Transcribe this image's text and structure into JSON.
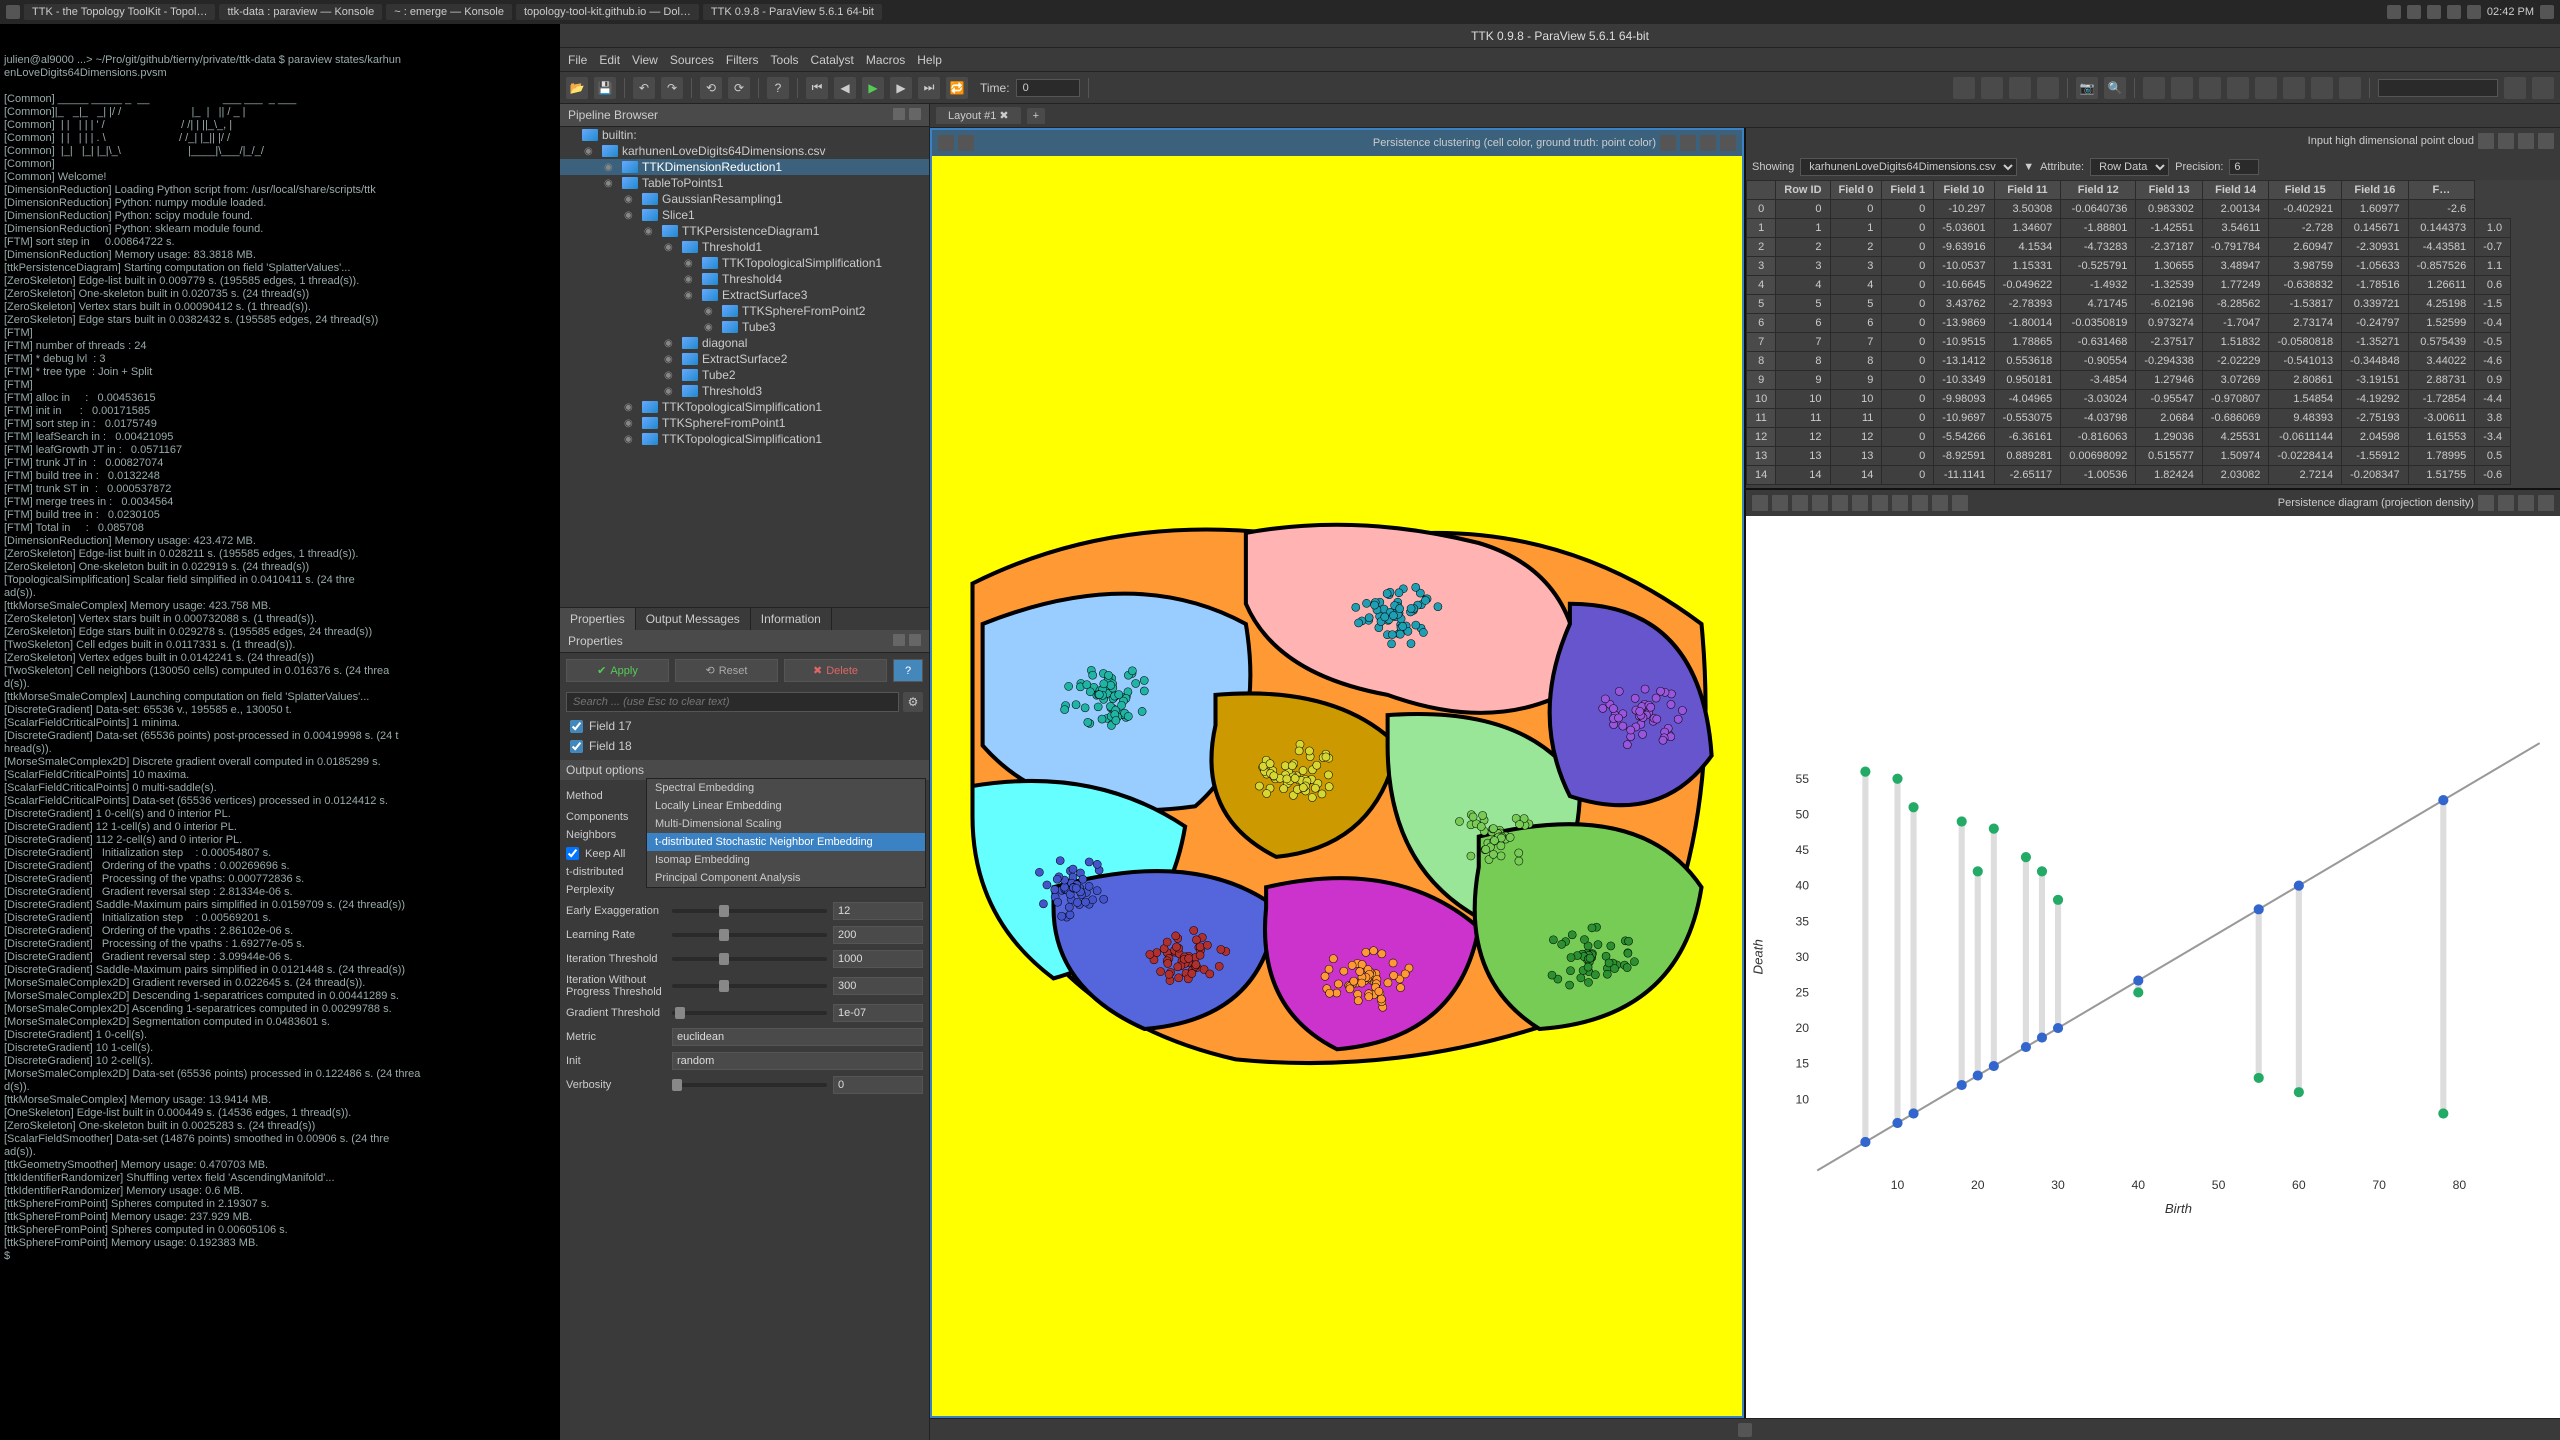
{
  "sysbar": {
    "tabs": [
      "TTK - the Topology ToolKit - Topol…",
      "ttk-data : paraview — Konsole",
      "~ : emerge — Konsole",
      "topology-tool-kit.github.io — Dol…",
      "TTK 0.9.8 - ParaView 5.6.1 64-bit"
    ],
    "clock": "02:42 PM"
  },
  "terminal_snip": "julien@al9000 ...> ~/Pro/git/github/tierny/private/ttk-data $ paraview states/karhun\nenLoveDigits64Dimensions.pvsm\n\n[Common] _____ _____ _  __                        ___ ___  _ ___\n[Common]|_   _|_   _| |/ /                       |_  |   || / _ |\n[Common]  | |   | | | ' /                         / /| | ||_\\_, |\n[Common]  | |   | | | . \\                        / /_| |_|| |/ /\n[Common]  |_|   |_| |_|\\_\\                      |____|\\___/|_/_/\n[Common]\n[Common] Welcome!\n[DimensionReduction] Loading Python script from: /usr/local/share/scripts/ttk\n[DimensionReduction] Python: numpy module loaded.\n[DimensionReduction] Python: scipy module found.\n[DimensionReduction] Python: sklearn module found.\n[FTM] sort step in     0.00864722 s.\n[DimensionReduction] Memory usage: 83.3818 MB.\n[ttkPersistenceDiagram] Starting computation on field 'SplatterValues'...\n[ZeroSkeleton] Edge-list built in 0.009779 s. (195585 edges, 1 thread(s)).\n[ZeroSkeleton] One-skeleton built in 0.020735 s. (24 thread(s))\n[ZeroSkeleton] Vertex stars built in 0.00090412 s. (1 thread(s)).\n[ZeroSkeleton] Edge stars built in 0.0382432 s. (195585 edges, 24 thread(s))\n[FTM]\n[FTM] number of threads : 24\n[FTM] * debug lvl  : 3\n[FTM] * tree type  : Join + Split\n[FTM]\n[FTM] alloc in     :   0.00453615\n[FTM] init in      :   0.00171585\n[FTM] sort step in :   0.0175749\n[FTM] leafSearch in :   0.00421095\n[FTM] leafGrowth JT in :   0.0571167\n[FTM] trunk JT in  :   0.00827074\n[FTM] build tree in :   0.0132248\n[FTM] trunk ST in  :   0.000537872\n[FTM] merge trees in :   0.0034564\n[FTM] build tree in :   0.0230105\n[FTM] Total in     :   0.085708\n[DimensionReduction] Memory usage: 423.472 MB.\n[ZeroSkeleton] Edge-list built in 0.028211 s. (195585 edges, 1 thread(s)).\n[ZeroSkeleton] One-skeleton built in 0.022919 s. (24 thread(s))\n[TopologicalSimplification] Scalar field simplified in 0.0410411 s. (24 thre\nad(s)).\n[ttkMorseSmaleComplex] Memory usage: 423.758 MB.\n[ZeroSkeleton] Vertex stars built in 0.000732088 s. (1 thread(s)).\n[ZeroSkeleton] Edge stars built in 0.029278 s. (195585 edges, 24 thread(s))\n[TwoSkeleton] Cell edges built in 0.0117331 s. (1 thread(s)).\n[ZeroSkeleton] Vertex edges built in 0.0142241 s. (24 thread(s))\n[TwoSkeleton] Cell neighbors (130050 cells) computed in 0.016376 s. (24 threa\nd(s)).\n[ttkMorseSmaleComplex] Launching computation on field 'SplatterValues'...\n[DiscreteGradient] Data-set: 65536 v., 195585 e., 130050 t.\n[ScalarFieldCriticalPoints] 1 minima.\n[DiscreteGradient] Data-set (65536 points) post-processed in 0.00419998 s. (24 t\nhread(s)).\n[MorseSmaleComplex2D] Discrete gradient overall computed in 0.0185299 s.\n[ScalarFieldCriticalPoints] 10 maxima.\n[ScalarFieldCriticalPoints] 0 multi-saddle(s).\n[ScalarFieldCriticalPoints] Data-set (65536 vertices) processed in 0.0124412 s.\n[DiscreteGradient] 1 0-cell(s) and 0 interior PL.\n[DiscreteGradient] 12 1-cell(s) and 0 interior PL.\n[DiscreteGradient] 112 2-cell(s) and 0 interior PL.\n[DiscreteGradient]   Initialization step    : 0.00054807 s.\n[DiscreteGradient]   Ordering of the vpaths : 0.00269696 s.\n[DiscreteGradient]   Processing of the vpaths: 0.000772836 s.\n[DiscreteGradient]   Gradient reversal step : 2.81334e-06 s.\n[DiscreteGradient] Saddle-Maximum pairs simplified in 0.0159709 s. (24 thread(s))\n[DiscreteGradient]   Initialization step    : 0.00569201 s.\n[DiscreteGradient]   Ordering of the vpaths : 2.86102e-06 s.\n[DiscreteGradient]   Processing of the vpaths : 1.69277e-05 s.\n[DiscreteGradient]   Gradient reversal step : 3.09944e-06 s.\n[DiscreteGradient] Saddle-Maximum pairs simplified in 0.0121448 s. (24 thread(s))\n[MorseSmaleComplex2D] Gradient reversed in 0.022645 s. (24 thread(s)).\n[MorseSmaleComplex2D] Descending 1-separatrices computed in 0.00441289 s.\n[MorseSmaleComplex2D] Ascending 1-separatrices computed in 0.00299788 s.\n[MorseSmaleComplex2D] Segmentation computed in 0.0483601 s.\n[DiscreteGradient] 1 0-cell(s).\n[DiscreteGradient] 10 1-cell(s).\n[DiscreteGradient] 10 2-cell(s).\n[MorseSmaleComplex2D] Data-set (65536 points) processed in 0.122486 s. (24 threa\nd(s)).\n[ttkMorseSmaleComplex] Memory usage: 13.9414 MB.\n[OneSkeleton] Edge-list built in 0.000449 s. (14536 edges, 1 thread(s)).\n[ZeroSkeleton] One-skeleton built in 0.0025283 s. (24 thread(s))\n[ScalarFieldSmoother] Data-set (14876 points) smoothed in 0.00906 s. (24 thre\nad(s)).\n[ttkGeometrySmoother] Memory usage: 0.470703 MB.\n[ttkIdentifierRandomizer] Shuffling vertex field 'AscendingManifold'...\n[ttkIdentifierRandomizer] Memory usage: 0.6 MB.\n[ttkSphereFromPoint] Spheres computed in 2.19307 s.\n[ttkSphereFromPoint] Memory usage: 237.929 MB.\n[ttkSphereFromPoint] Spheres computed in 0.00605106 s.\n[ttkSphereFromPoint] Memory usage: 0.192383 MB.\n$",
  "pv": {
    "title": "TTK 0.9.8 - ParaView 5.6.1 64-bit",
    "menu": [
      "File",
      "Edit",
      "View",
      "Sources",
      "Filters",
      "Tools",
      "Catalyst",
      "Macros",
      "Help"
    ],
    "toolbar_time_label": "Time:",
    "toolbar_time_value": "0",
    "layout_tab": "Layout #1",
    "pipeline_panel": "Pipeline Browser",
    "tree": [
      {
        "l": 0,
        "t": "builtin:",
        "i": "server"
      },
      {
        "l": 1,
        "t": "karhunenLoveDigits64Dimensions.csv"
      },
      {
        "l": 2,
        "t": "TTKDimensionReduction1",
        "sel": true
      },
      {
        "l": 2,
        "t": "TableToPoints1"
      },
      {
        "l": 3,
        "t": "GaussianResampling1"
      },
      {
        "l": 3,
        "t": "Slice1"
      },
      {
        "l": 4,
        "t": "TTKPersistenceDiagram1"
      },
      {
        "l": 5,
        "t": "Threshold1"
      },
      {
        "l": 6,
        "t": "TTKTopologicalSimplification1"
      },
      {
        "l": 6,
        "t": "Threshold4"
      },
      {
        "l": 6,
        "t": "ExtractSurface3"
      },
      {
        "l": 7,
        "t": "TTKSphereFromPoint2"
      },
      {
        "l": 7,
        "t": "Tube3"
      },
      {
        "l": 5,
        "t": "diagonal"
      },
      {
        "l": 5,
        "t": "ExtractSurface2"
      },
      {
        "l": 5,
        "t": "Tube2"
      },
      {
        "l": 5,
        "t": "Threshold3"
      },
      {
        "l": 3,
        "t": "TTKTopologicalSimplification1"
      },
      {
        "l": 3,
        "t": "TTKSphereFromPoint1"
      },
      {
        "l": 3,
        "t": "TTKTopologicalSimplification1"
      }
    ],
    "tabs": [
      "Properties",
      "Output Messages",
      "Information"
    ],
    "tabs_active": 0,
    "properties_header": "Properties",
    "btn_apply": "Apply",
    "btn_reset": "Reset",
    "btn_delete": "Delete",
    "search_ph": "Search ... (use Esc to clear text)",
    "field17": "Field 17",
    "field18": "Field 18",
    "section_output": "Output options",
    "lbl_method": "Method",
    "val_method": "t-distributed Stochastic Neighbor Embed",
    "lbl_components": "Components",
    "lbl_neighbors": "Neighbors",
    "lbl_keepall": "Keep All",
    "lbl_tsne": "t-distributed",
    "lbl_perplexity": "Perplexity",
    "lbl_earlyexag": "Early Exaggeration",
    "val_earlyexag": "12",
    "lbl_lrate": "Learning Rate",
    "val_lrate": "200",
    "lbl_iter": "Iteration Threshold",
    "val_iter": "1000",
    "lbl_iterwp": "Iteration Without Progress Threshold",
    "val_iterwp": "300",
    "lbl_grad": "Gradient Threshold",
    "val_grad": "1e-07",
    "lbl_metric": "Metric",
    "val_metric": "euclidean",
    "lbl_init": "Init",
    "val_init": "random",
    "lbl_verbose": "Verbosity",
    "val_verbose": "0",
    "dropdown": {
      "opts": [
        "Spectral Embedding",
        "Locally Linear Embedding",
        "Multi-Dimensional Scaling",
        "t-distributed Stochastic Neighbor Embedding",
        "Isomap Embedding",
        "Principal Component Analysis"
      ],
      "sel": 3
    },
    "view_tl": {
      "title": "Input high dimensional point cloud"
    },
    "view_tr": {
      "title": "Persistence clustering (cell color, ground truth: point color)"
    },
    "view_bl": {
      "title": "Persistence diagram (projection density)"
    },
    "sheet": {
      "showing": "Showing",
      "source": "karhunenLoveDigits64Dimensions.csv",
      "attr_lbl": "Attribute:",
      "attr": "Row Data",
      "prec_lbl": "Precision:",
      "prec": "6",
      "cols": [
        "",
        "Row ID",
        "Field 0",
        "Field 1",
        "Field 10",
        "Field 11",
        "Field 12",
        "Field 13",
        "Field 14",
        "Field 15",
        "Field 16",
        "F…"
      ],
      "rows": [
        [
          "0",
          "0",
          "0",
          "-10.297",
          "3.50308",
          "-0.0640736",
          "0.983302",
          "2.00134",
          "-0.402921",
          "1.60977",
          "-2.6"
        ],
        [
          "1",
          "1",
          "0",
          "-5.03601",
          "1.34607",
          "-1.88801",
          "-1.42551",
          "3.54611",
          "-2.728",
          "0.145671",
          "0.144373",
          "1.0"
        ],
        [
          "2",
          "2",
          "0",
          "-9.63916",
          "4.1534",
          "-4.73283",
          "-2.37187",
          "-0.791784",
          "2.60947",
          "-2.30931",
          "-4.43581",
          "-0.7"
        ],
        [
          "3",
          "3",
          "0",
          "-10.0537",
          "1.15331",
          "-0.525791",
          "1.30655",
          "3.48947",
          "3.98759",
          "-1.05633",
          "-0.857526",
          "1.1"
        ],
        [
          "4",
          "4",
          "0",
          "-10.6645",
          "-0.049622",
          "-1.4932",
          "-1.32539",
          "1.77249",
          "-0.638832",
          "-1.78516",
          "1.26611",
          "0.6"
        ],
        [
          "5",
          "5",
          "0",
          "3.43762",
          "-2.78393",
          "4.71745",
          "-6.02196",
          "-8.28562",
          "-1.53817",
          "0.339721",
          "4.25198",
          "-1.5"
        ],
        [
          "6",
          "6",
          "0",
          "-13.9869",
          "-1.80014",
          "-0.0350819",
          "0.973274",
          "-1.7047",
          "2.73174",
          "-0.24797",
          "1.52599",
          "-0.4"
        ],
        [
          "7",
          "7",
          "0",
          "-10.9515",
          "1.78865",
          "-0.631468",
          "-2.37517",
          "1.51832",
          "-0.0580818",
          "-1.35271",
          "0.575439",
          "-0.5"
        ],
        [
          "8",
          "8",
          "0",
          "-13.1412",
          "0.553618",
          "-0.90554",
          "-0.294338",
          "-2.02229",
          "-0.541013",
          "-0.344848",
          "3.44022",
          "-4.6"
        ],
        [
          "9",
          "9",
          "0",
          "-10.3349",
          "0.950181",
          "-3.4854",
          "1.27946",
          "3.07269",
          "2.80861",
          "-3.19151",
          "2.88731",
          "0.9"
        ],
        [
          "10",
          "10",
          "0",
          "-9.98093",
          "-4.04965",
          "-3.03024",
          "-0.95547",
          "-0.970807",
          "1.54854",
          "-4.19292",
          "-1.72854",
          "-4.4"
        ],
        [
          "11",
          "11",
          "0",
          "-10.9697",
          "-0.553075",
          "-4.03798",
          "2.0684",
          "-0.686069",
          "9.48393",
          "-2.75193",
          "-3.00611",
          "3.8"
        ],
        [
          "12",
          "12",
          "0",
          "-5.54266",
          "-6.36161",
          "-0.816063",
          "1.29036",
          "4.25531",
          "-0.0611144",
          "2.04598",
          "1.61553",
          "-3.4"
        ],
        [
          "13",
          "13",
          "0",
          "-8.92591",
          "0.889281",
          "0.00698092",
          "0.515577",
          "1.50974",
          "-0.0228414",
          "-1.55912",
          "1.78995",
          "0.5"
        ],
        [
          "14",
          "14",
          "0",
          "-11.1141",
          "-2.65117",
          "-1.00536",
          "1.82424",
          "2.03082",
          "2.7214",
          "-0.208347",
          "1.51755",
          "-0.6"
        ]
      ]
    },
    "chart_data": {
      "type": "scatter",
      "title": "",
      "xlabel": "Birth",
      "ylabel": "Death",
      "xlim": [
        0,
        90
      ],
      "ylim": [
        0,
        60
      ],
      "xticks": [
        10,
        20,
        30,
        40,
        50,
        60,
        70,
        80
      ],
      "yticks": [
        10,
        15,
        20,
        25,
        30,
        35,
        40,
        45,
        50,
        55
      ],
      "series": [
        {
          "name": "diagonal",
          "type": "line",
          "x": [
            0,
            90
          ],
          "y": [
            0,
            60
          ]
        },
        {
          "name": "bars",
          "type": "bar",
          "pairs": [
            [
              6,
              56
            ],
            [
              10,
              55
            ],
            [
              12,
              51
            ],
            [
              18,
              49
            ],
            [
              20,
              42
            ],
            [
              22,
              48
            ],
            [
              26,
              44
            ],
            [
              28,
              42
            ],
            [
              30,
              38
            ],
            [
              40,
              25
            ],
            [
              55,
              13
            ],
            [
              60,
              11
            ],
            [
              78,
              8
            ]
          ]
        }
      ]
    }
  }
}
